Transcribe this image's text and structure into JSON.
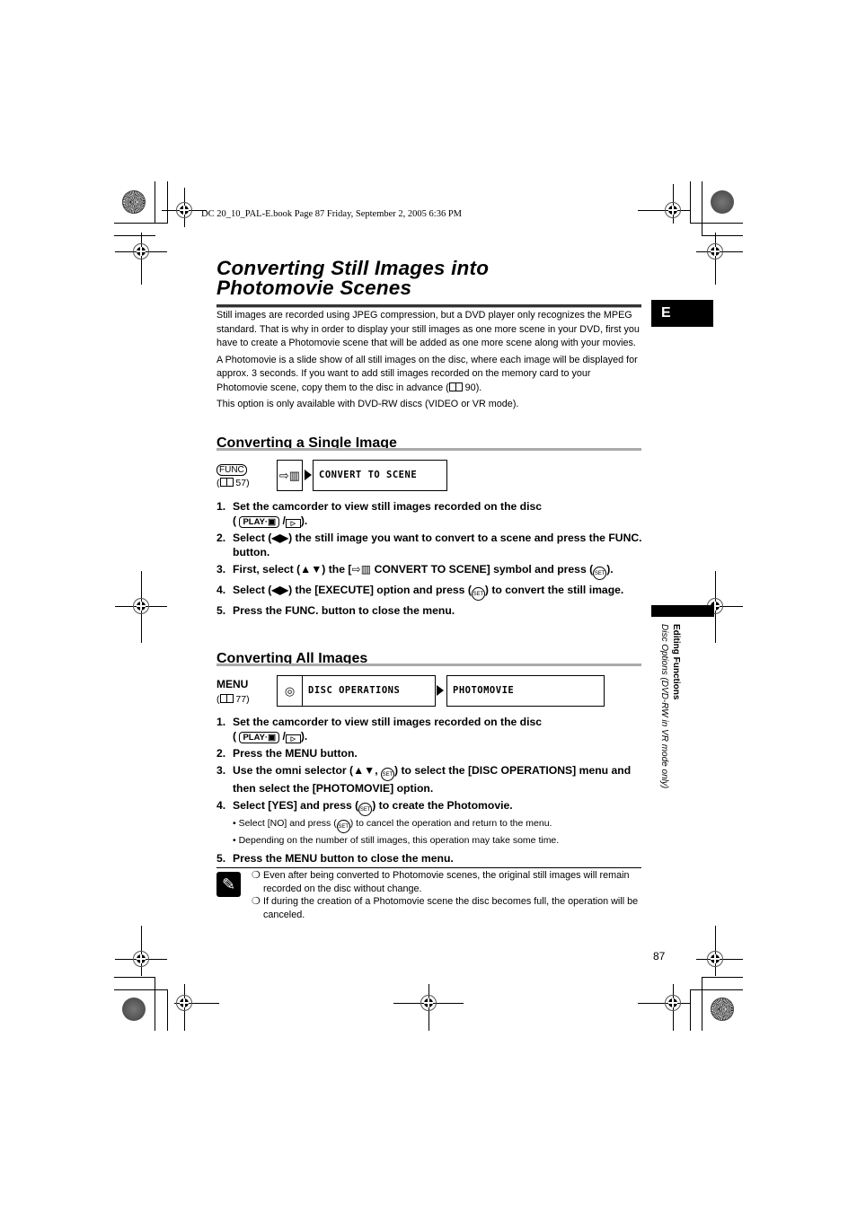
{
  "print_header": "DC 20_10_PAL-E.book  Page 87  Friday, September 2, 2005  6:36 PM",
  "title_lines": [
    "Converting Still Images into",
    "Photomovie Scenes"
  ],
  "language_tab": "E",
  "side_tab": {
    "section": "Editing Functions",
    "subsection": "Disc Options (DVD-RW in VR mode only)"
  },
  "intro": {
    "p1": "Still images are recorded using JPEG compression, but a DVD player only recognizes the MPEG standard. That is why in order to display your still images as one more scene in your DVD, first you have to create a Photomovie scene that will be added as one more scene along with your movies.",
    "p2_before": "A Photomovie is a slide show of all still images on the disc, where each image will be displayed for approx. 3 seconds. If you want to add still images recorded on the memory card to your Photomovie scene, copy them to the disc in advance (",
    "p2_ref": "90",
    "p2_after": ").",
    "p3": "This option is only available with DVD-RW discs (VIDEO or VR mode)."
  },
  "section_single": {
    "heading": "Converting a Single Image",
    "button_label": "FUNC",
    "ref_page": "57",
    "menu_icon": "convert-to-scene-icon",
    "menu_item": "CONVERT TO SCENE",
    "steps": [
      {
        "n": "1.",
        "text": "Set the camcorder to view still images recorded on the disc",
        "mode_pill": "PLAY·▣",
        "mode_suffix": ")."
      },
      {
        "n": "2.",
        "text": "Select (◀▶) the still image you want to convert to a scene and press the FUNC. button."
      },
      {
        "n": "3.",
        "text_a": "First, select (▲▼) the [",
        "text_b": " CONVERT TO SCENE] symbol and press (",
        "text_c": ")."
      },
      {
        "n": "4.",
        "text_a": "Select (◀▶) the [EXECUTE] option and press (",
        "text_b": ") to convert the still image."
      },
      {
        "n": "5.",
        "text": "Press the FUNC. button to close the menu."
      }
    ]
  },
  "section_all": {
    "heading": "Converting All Images",
    "button_label": "MENU",
    "ref_page": "77",
    "menu_icon": "disc-icon",
    "menu_item": "DISC OPERATIONS",
    "submenu_item": "PHOTOMOVIE",
    "steps": [
      {
        "n": "1.",
        "text": "Set the camcorder to view still images recorded on the disc",
        "mode_pill": "PLAY·▣",
        "mode_suffix": ")."
      },
      {
        "n": "2.",
        "text": "Press the MENU button."
      },
      {
        "n": "3.",
        "text_a": "Use the omni selector (▲▼, ",
        "text_b": ") to select the [DISC OPERATIONS] menu and then select the [PHOTOMOVIE] option."
      },
      {
        "n": "4.",
        "text_a": "Select [YES] and press (",
        "text_b": ") to create the Photomovie.",
        "subs": [
          {
            "a": "Select [NO] and press (",
            "b": ") to cancel the operation and return to the menu."
          },
          {
            "a": "Depending on the number of still images, this operation may take some time.",
            "b": ""
          }
        ]
      },
      {
        "n": "5.",
        "text": "Press the MENU button to close the menu."
      }
    ]
  },
  "set_label": "SET",
  "notes": [
    "Even after being converted to Photomovie scenes, the original still images will remain recorded on the disc without change.",
    "If during the creation of a Photomovie scene the disc becomes full, the operation will be canceled."
  ],
  "page_number": "87"
}
